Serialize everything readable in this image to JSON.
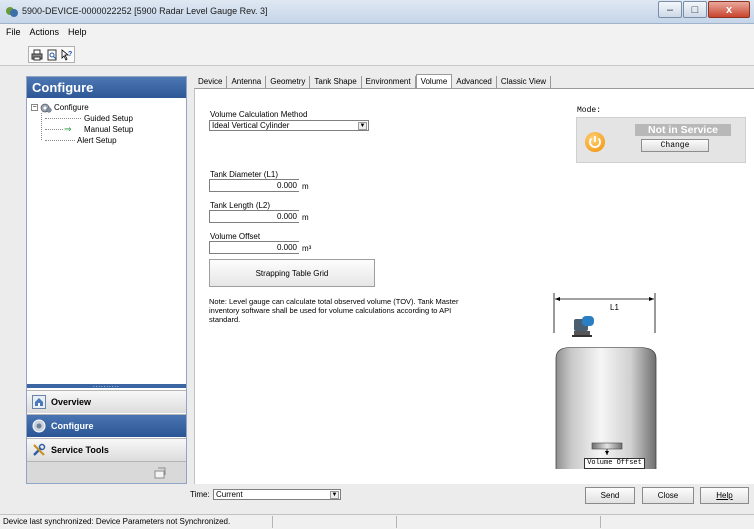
{
  "window": {
    "title": "5900-DEVICE-0000022252 [5900 Radar Level Gauge Rev. 3]",
    "minimize_glyph": "–",
    "maximize_glyph": "□",
    "close_glyph": "x"
  },
  "menu": [
    "File",
    "Actions",
    "Help"
  ],
  "toolbar": {
    "icons": [
      "print-icon",
      "print-preview-icon",
      "help-pointer-icon"
    ]
  },
  "sidebar": {
    "header": "Configure",
    "tree": {
      "root": "Configure",
      "expander": "−",
      "items": [
        "Guided Setup",
        "Manual Setup",
        "Alert Setup"
      ],
      "selected": "Manual Setup"
    },
    "grip": "..........",
    "nav": {
      "overview": "Overview",
      "configure": "Configure",
      "service_tools": "Service Tools"
    }
  },
  "tabs": [
    "Device",
    "Antenna",
    "Geometry",
    "Tank Shape",
    "Environment",
    "Volume",
    "Advanced",
    "Classic View"
  ],
  "active_tab": "Volume",
  "volume": {
    "method_label": "Volume Calculation Method",
    "method_value": "Ideal Vertical Cylinder",
    "diameter_label": "Tank Diameter (L1)",
    "diameter_value": "0.000",
    "diameter_unit": "m",
    "length_label": "Tank Length (L2)",
    "length_value": "0.000",
    "length_unit": "m",
    "offset_label": "Volume Offset",
    "offset_value": "0.000",
    "offset_unit": "m³",
    "strapping_button": "Strapping Table Grid",
    "note": "Note: Level gauge can calculate total observed volume (TOV). Tank Master inventory software shall be used for volume calculations according to API standard."
  },
  "mode": {
    "label": "Mode:",
    "status": "Not in Service",
    "change_button": "Change"
  },
  "diagram": {
    "l1_label": "L1",
    "volume_offset_label": "Volume Offset"
  },
  "bottom": {
    "time_label": "Time:",
    "time_value": "Current",
    "send": "Send",
    "close": "Close",
    "help": "Help"
  },
  "status": {
    "text": "Device last synchronized: Device Parameters not Synchronized."
  },
  "colors": {
    "accent": "#2d5796",
    "mode_orange": "#f08d00",
    "title_gradient": "#c5d5e8"
  }
}
